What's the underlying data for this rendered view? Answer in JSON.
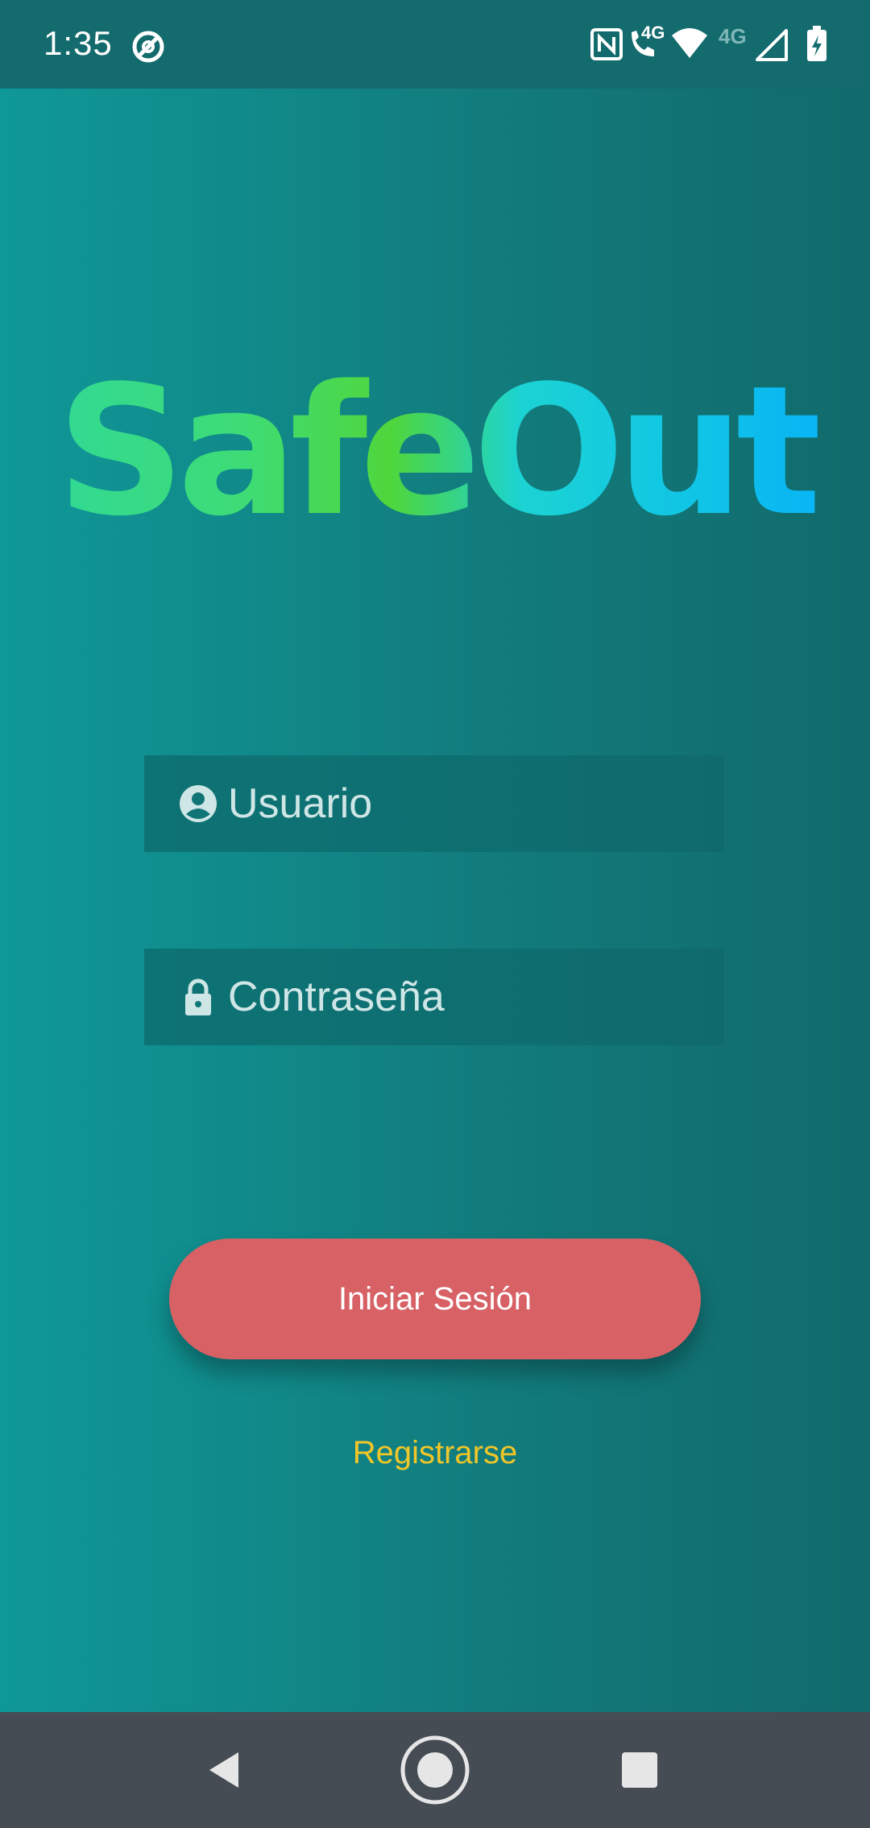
{
  "status_bar": {
    "time": "1:35",
    "icons": [
      "sync-icon",
      "nfc-icon",
      "volte-call-icon",
      "wifi-icon",
      "signal-icon",
      "battery-charging-icon"
    ],
    "call_network_label": "4G",
    "mobile_network_label": "4G"
  },
  "app": {
    "logo_text": "SafeOut",
    "logo_colors": [
      "#2ed89b",
      "#4fd63c",
      "#1bd3d4",
      "#06aefb"
    ],
    "username": {
      "placeholder": "Usuario",
      "value": "",
      "icon": "account-circle-icon"
    },
    "password": {
      "placeholder": "Contraseña",
      "value": "",
      "icon": "lock-icon"
    },
    "login_button_label": "Iniciar Sesión",
    "register_link_label": "Registrarse"
  },
  "colors": {
    "accent_button": "#d76165",
    "link": "#f1c628",
    "background": "#0f7f82"
  },
  "nav_bar": {
    "buttons": [
      "back-icon",
      "home-icon",
      "recents-icon"
    ]
  }
}
